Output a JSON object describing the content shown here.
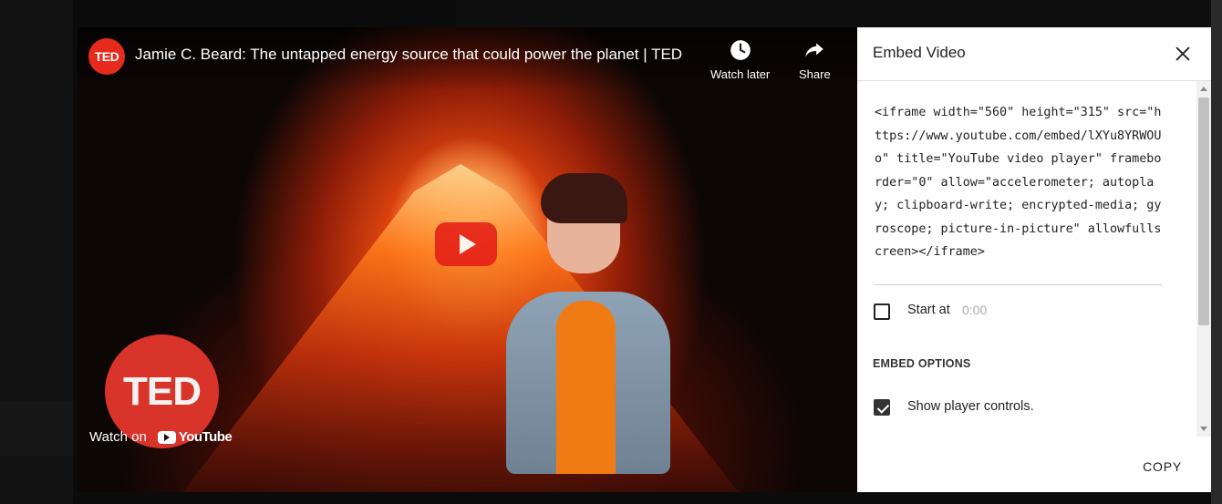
{
  "video": {
    "channel": "TED",
    "title": "Jamie C. Beard: The untapped energy source that could power the planet | TED",
    "watch_later": "Watch later",
    "share": "Share",
    "badge": "TED",
    "watch_on": "Watch on",
    "youtube": "YouTube"
  },
  "panel": {
    "title": "Embed Video",
    "embed_code": "<iframe width=\"560\" height=\"315\" src=\"https://www.youtube.com/embed/lXYu8YRWOUo\" title=\"YouTube video player\" frameborder=\"0\" allow=\"accelerometer; autoplay; clipboard-write; encrypted-media; gyroscope; picture-in-picture\" allowfullscreen></iframe>",
    "start_at_label": "Start at",
    "start_at_time": "0:00",
    "start_at_checked": false,
    "embed_options_heading": "EMBED OPTIONS",
    "show_controls_label": "Show player controls.",
    "show_controls_checked": true,
    "copy_label": "COPY"
  },
  "colors": {
    "brand_red": "#e62b1e",
    "play_red": "#e62117",
    "panel_bg": "#ffffff"
  },
  "icons": [
    "clock-icon",
    "share-arrow-icon",
    "close-icon",
    "play-icon",
    "youtube-logo-icon"
  ]
}
